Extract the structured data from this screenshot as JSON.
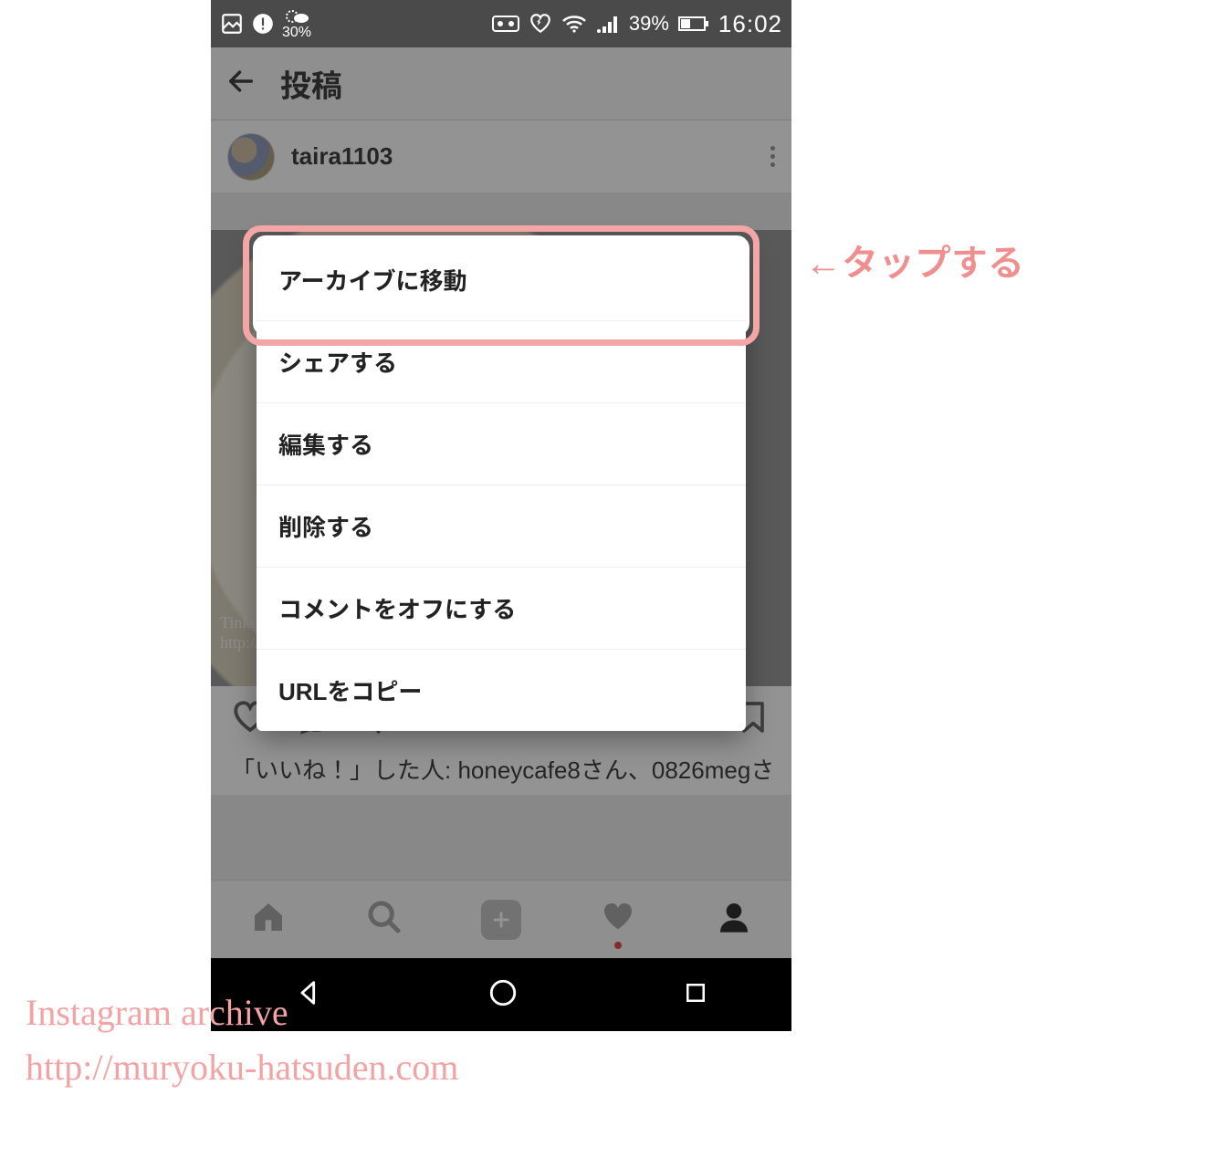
{
  "status": {
    "weather_percent": "30%",
    "battery_percent": "39%",
    "time": "16:02"
  },
  "header": {
    "title": "投稿"
  },
  "post": {
    "username": "taira1103",
    "likes_line": "「いいね！」した人: honeycafe8さん、0826megさ",
    "image_watermark_line1": "Tinke",
    "image_watermark_line2": "http://"
  },
  "menu": {
    "items": [
      "アーカイブに移動",
      "シェアする",
      "編集する",
      "削除する",
      "コメントをオフにする",
      "URLをコピー"
    ]
  },
  "annotation": {
    "tap_hint": "←タップする"
  },
  "footer_note": {
    "line1": "Instagram archive",
    "line2": "http://muryoku-hatsuden.com"
  }
}
